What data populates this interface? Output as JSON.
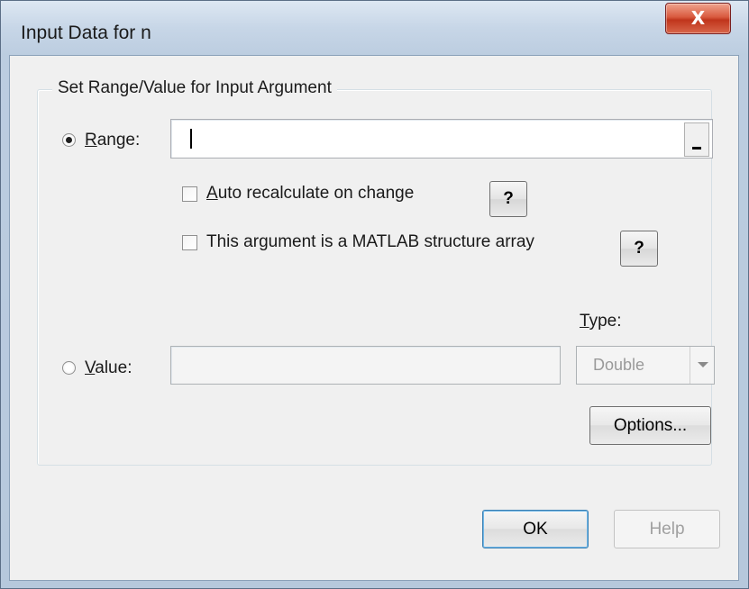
{
  "window": {
    "title": "Input Data for n",
    "close_glyph": "X"
  },
  "group": {
    "label": "Set Range/Value for Input Argument"
  },
  "range": {
    "label_ul": "R",
    "label_rest": "ange:",
    "value": "",
    "selected": true,
    "button_icon": "collapse-dialog-icon"
  },
  "options": {
    "auto_recalc": {
      "label_ul": "A",
      "label_rest": "uto recalculate on change",
      "checked": false
    },
    "struct_array": {
      "label": "This argument is a MATLAB structure array",
      "checked": false
    },
    "help_label": "?"
  },
  "value": {
    "label_ul": "V",
    "label_rest": "alue:",
    "value": "",
    "selected": false
  },
  "type": {
    "label_ul": "T",
    "label_rest": "ype:",
    "selected": "Double"
  },
  "buttons": {
    "options": "Options...",
    "ok": "OK",
    "help": "Help"
  }
}
